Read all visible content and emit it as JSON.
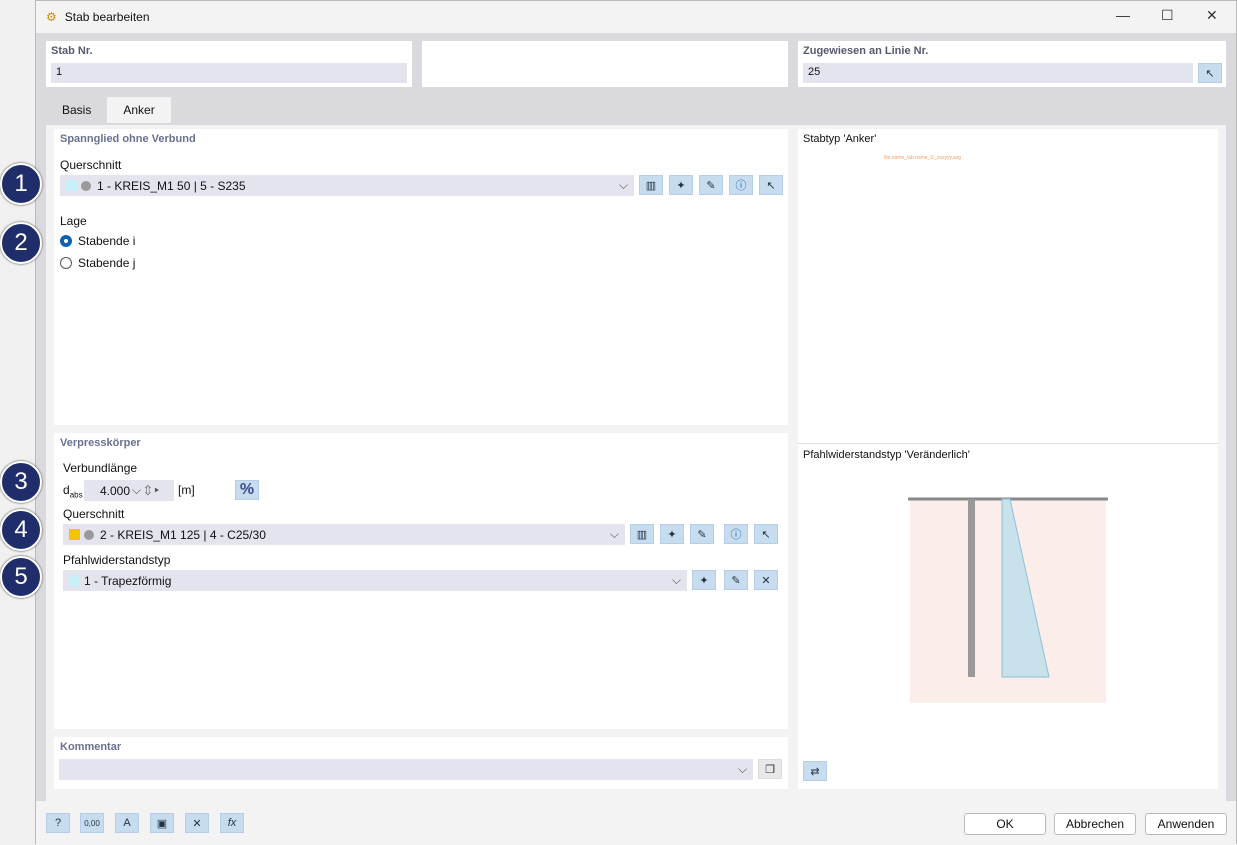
{
  "window": {
    "title": "Stab bearbeiten"
  },
  "header": {
    "member_no_label": "Stab Nr.",
    "member_no": "1",
    "assigned_label": "Zugewiesen an Linie Nr.",
    "assigned": "25"
  },
  "tabs": [
    {
      "label": "Basis"
    },
    {
      "label": "Anker"
    }
  ],
  "tendon": {
    "title": "Spannglied ohne Verbund",
    "section_label": "Querschnitt",
    "section_value": "1 - KREIS_M1 50 | 5 - S235",
    "section_color": "#c8f0f8",
    "position_label": "Lage",
    "options": [
      "Stabende i",
      "Stabende j"
    ],
    "selected": "Stabende i"
  },
  "grout": {
    "title": "Verpresskörper",
    "bond_length_label": "Verbundlänge",
    "d_label": "d",
    "d_sub": "abs",
    "d_value": "4.000",
    "d_unit": "[m]",
    "percent_label": "%",
    "section_label": "Querschnitt",
    "section_value": "2 - KREIS_M1 125 | 4 - C25/30",
    "section_color": "#f5c400",
    "pile_label": "Pfahlwiderstandstyp",
    "pile_value": "1 - Trapezförmig",
    "pile_color": "#c8f0f8"
  },
  "comment": {
    "label": "Kommentar",
    "value": ""
  },
  "preview": {
    "type_title": "Stabtyp 'Anker'",
    "missing_file": "file.name_lab.name_l1_xxxyyy.svg",
    "pile_title": "Pfahlwiderstandstyp 'Veränderlich'"
  },
  "badges": [
    "1",
    "2",
    "3",
    "4",
    "5"
  ],
  "buttons": {
    "ok": "OK",
    "cancel": "Abbrechen",
    "apply": "Anwenden"
  },
  "footer_icons": [
    "help-icon",
    "units-icon",
    "display-icon",
    "model-icon",
    "delete-icon",
    "formula-icon"
  ]
}
